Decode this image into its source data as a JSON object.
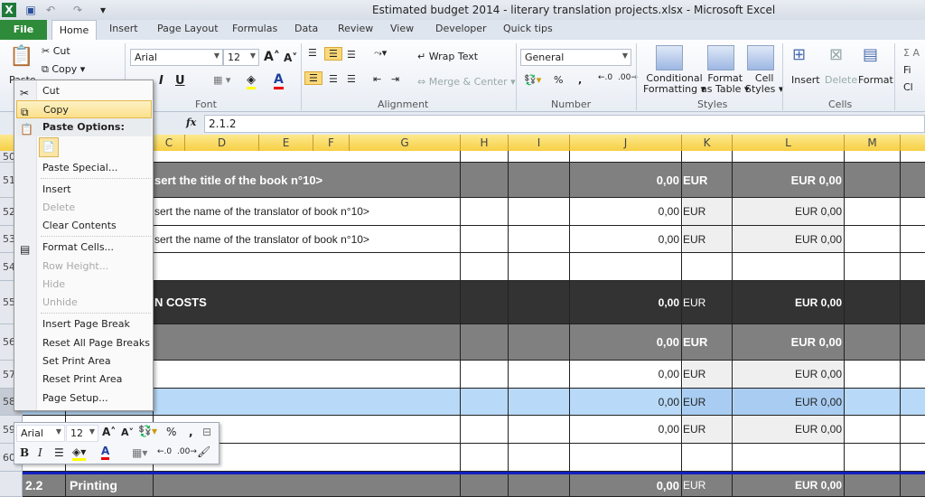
{
  "window": {
    "title": "Estimated budget 2014 - literary translation projects.xlsx  -  Microsoft Excel"
  },
  "qat": {
    "app_icon": "excel-icon",
    "save": "save-icon",
    "undo": "undo-icon",
    "redo": "redo-icon"
  },
  "tabs": [
    "File",
    "Home",
    "Insert",
    "Page Layout",
    "Formulas",
    "Data",
    "Review",
    "View",
    "Developer",
    "Quick tips"
  ],
  "ribbon": {
    "clipboard": {
      "paste": "Paste",
      "cut": "Cut",
      "copy": "Copy"
    },
    "font": {
      "name": "Arial",
      "size": "12",
      "label": "Font",
      "bold": "B",
      "italic": "I",
      "underline": "U"
    },
    "alignment": {
      "wrap": "Wrap Text",
      "merge": "Merge & Center",
      "label": "Alignment"
    },
    "number": {
      "format": "General",
      "percent": "%",
      "comma": ",",
      "label": "Number"
    },
    "styles": {
      "conditional": "Conditional",
      "conditional2": "Formatting",
      "table": "Format",
      "table2": "as Table",
      "cell": "Cell",
      "cell2": "Styles",
      "label": "Styles"
    },
    "cells": {
      "insert": "Insert",
      "delete": "Delete",
      "format": "Format",
      "label": "Cells"
    },
    "editing": {
      "a": "Σ A",
      "b": "Fi",
      "c": "Cl"
    }
  },
  "formula_bar": {
    "fx": "fx",
    "value": "2.1.2"
  },
  "columns": [
    "C",
    "D",
    "E",
    "F",
    "G",
    "H",
    "I",
    "J",
    "K",
    "L",
    "M"
  ],
  "rows": [
    {
      "n": "50",
      "style": "blank",
      "text": "",
      "j": "",
      "k": "",
      "l": ""
    },
    {
      "n": "51",
      "style": "gray",
      "text": "sert the title of the book n°10>",
      "j": "0,00",
      "k": "EUR",
      "l": "EUR 0,00"
    },
    {
      "n": "52",
      "style": "white",
      "text": "sert the name of the translator of book n°10>",
      "j": "0,00",
      "k": "EUR",
      "l": "EUR 0,00"
    },
    {
      "n": "53",
      "style": "white",
      "text": "sert the name of the translator of book n°10>",
      "j": "0,00",
      "k": "EUR",
      "l": "EUR 0,00"
    },
    {
      "n": "54",
      "style": "blank",
      "text": "",
      "j": "",
      "k": "",
      "l": ""
    },
    {
      "n": "55",
      "style": "dark",
      "text": "N COSTS",
      "j": "0,00",
      "k": "EUR",
      "l": "EUR 0,00"
    },
    {
      "n": "56",
      "style": "gray",
      "text": "",
      "j": "0,00",
      "k": "EUR",
      "l": "EUR 0,00"
    },
    {
      "n": "57",
      "style": "white",
      "text": "",
      "j": "0,00",
      "k": "EUR",
      "l": "EUR 0,00"
    },
    {
      "n": "58",
      "style": "sel",
      "text": "",
      "j": "0,00",
      "k": "EUR",
      "l": "EUR 0,00"
    },
    {
      "n": "59",
      "style": "white",
      "text": "",
      "j": "0,00",
      "k": "EUR",
      "l": "EUR 0,00"
    },
    {
      "n": "60",
      "style": "blank",
      "text": "",
      "j": "",
      "k": "",
      "l": ""
    },
    {
      "n": "",
      "style": "gray",
      "num": "2.2",
      "text": "Printing",
      "j": "0,00",
      "k": "EUR",
      "l": "EUR 0,00"
    }
  ],
  "context_menu": {
    "cut": "Cut",
    "copy": "Copy",
    "paste_options": "Paste Options:",
    "paste_special": "Paste Special...",
    "insert": "Insert",
    "delete": "Delete",
    "clear": "Clear Contents",
    "format_cells": "Format Cells...",
    "row_height": "Row Height...",
    "hide": "Hide",
    "unhide": "Unhide",
    "insert_break": "Insert Page Break",
    "reset_breaks": "Reset All Page Breaks",
    "set_print": "Set Print Area",
    "reset_print": "Reset Print Area",
    "page_setup": "Page Setup..."
  },
  "mini_toolbar": {
    "font": "Arial",
    "size": "12",
    "percent": "%",
    "comma": ",",
    "bold": "B",
    "italic": "I"
  },
  "colors": {
    "accent": "#f7cf45",
    "gray_row": "#808080",
    "dark_row": "#333333",
    "selected_row": "#b8d9f8",
    "file_tab": "#2e8b3a"
  }
}
